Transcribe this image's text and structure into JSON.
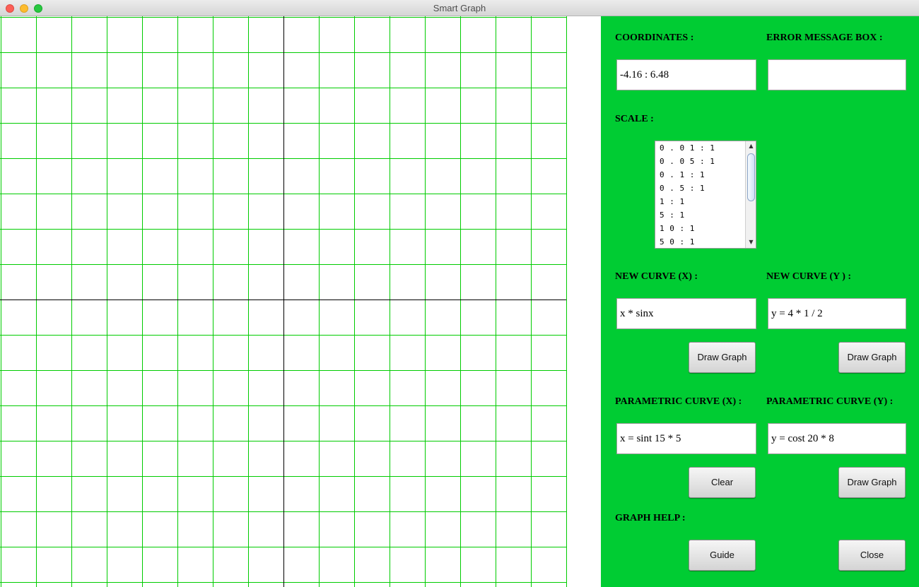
{
  "window": {
    "title": "Smart Graph"
  },
  "colors": {
    "panel": "#00cc33",
    "grid": "#00cc00",
    "axis": "#000000"
  },
  "labels": {
    "coordinates": "COORDINATES :",
    "error": "ERROR MESSAGE BOX :",
    "scale": "SCALE :",
    "new_curve_x": "NEW CURVE (X) :",
    "new_curve_y": "NEW CURVE (Y ) :",
    "param_x": "PARAMETRIC CURVE (X) :",
    "param_y": "PARAMETRIC CURVE (Y) :",
    "help": "GRAPH HELP :"
  },
  "fields": {
    "coordinates": "-4.16 : 6.48",
    "error": "",
    "new_curve_x": "x * sinx",
    "new_curve_y": "y = 4 * 1 / 2",
    "param_x": "x = sint 15 * 5",
    "param_y": "y = cost 20 * 8"
  },
  "scale": {
    "options": [
      "0 . 0 1 : 1",
      "0 . 0 5 : 1",
      "0 . 1 : 1",
      "0 . 5 : 1",
      "1 : 1",
      "5 : 1",
      "1 0 : 1",
      "5 0 : 1"
    ]
  },
  "buttons": {
    "draw_graph_x": "Draw Graph",
    "draw_graph_y": "Draw Graph",
    "clear": "Clear",
    "draw_graph_param": "Draw Graph",
    "guide": "Guide",
    "close": "Close"
  },
  "icons": {
    "scroll_up": "up-arrow-icon",
    "scroll_down": "down-arrow-icon"
  }
}
